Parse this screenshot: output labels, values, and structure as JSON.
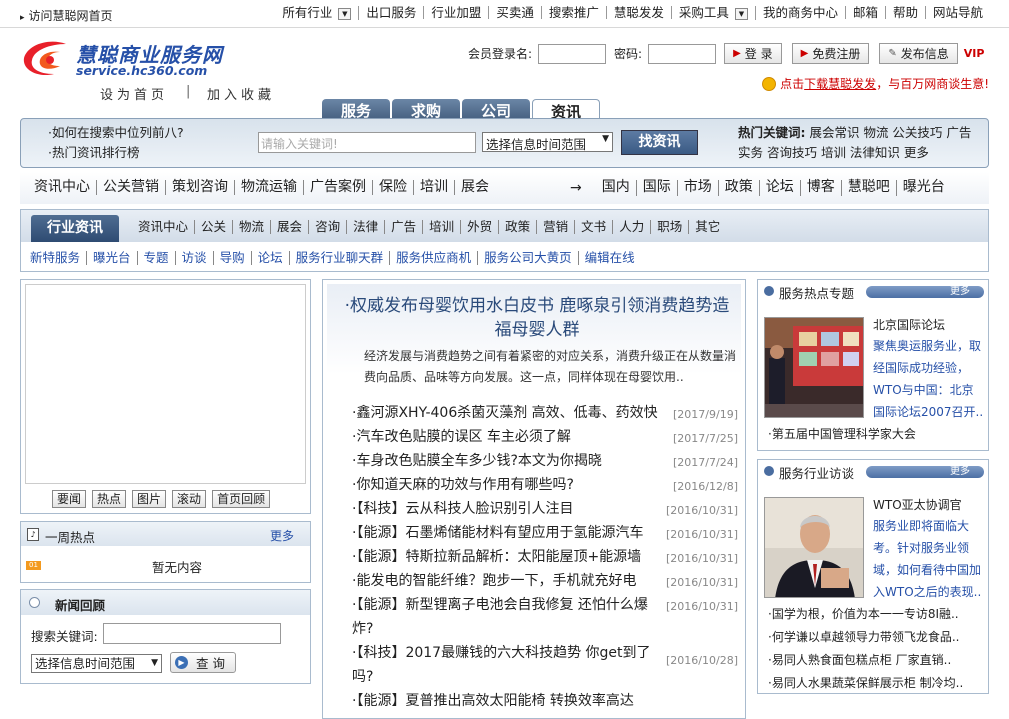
{
  "topbar": {
    "home_link": "访问慧聪网首页",
    "nav": [
      "所有行业",
      "出口服务",
      "行业加盟",
      "买卖通",
      "搜索推广",
      "慧聪发发",
      "采购工具",
      "我的商务中心",
      "邮箱",
      "帮助",
      "网站导航"
    ]
  },
  "logo": {
    "cn": "慧聪商业服务网",
    "en": "service.hc360.com"
  },
  "header_links": {
    "set_home": "设为首页",
    "add_fav": "加入收藏"
  },
  "login": {
    "member_label": "会员登录名:",
    "password_label": "密码:",
    "login_btn": "登 录",
    "register_btn": "免费注册",
    "publish_btn": "发布信息",
    "vip": "VIP"
  },
  "promo": {
    "prefix": "点击",
    "link": "下载慧聪发发",
    "suffix": "，与百万网商谈生意!"
  },
  "tabs": [
    "服务",
    "求购",
    "公司",
    "资讯"
  ],
  "search": {
    "links": [
      "如何在搜索中位列前八?",
      "热门资讯排行榜"
    ],
    "placeholder": "请输入关键词!",
    "select": "选择信息时间范围",
    "button": "找资讯",
    "hot_label": "热门关键词:",
    "hot_words": "展会常识 物流 公关技巧 广告实务 咨询技巧 培训 法律知识 更多"
  },
  "nav1": {
    "left": [
      "资讯中心",
      "公关营销",
      "策划咨询",
      "物流运输",
      "广告案例",
      "保险",
      "培训",
      "展会"
    ],
    "arrow": "→",
    "right": [
      "国内",
      "国际",
      "市场",
      "政策",
      "论坛",
      "博客",
      "慧聪吧",
      "曝光台"
    ]
  },
  "industry": {
    "title": "行业资讯",
    "cats": [
      "资讯中心",
      "公关",
      "物流",
      "展会",
      "咨询",
      "法律",
      "广告",
      "培训",
      "外贸",
      "政策",
      "营销",
      "文书",
      "人力",
      "职场",
      "其它"
    ],
    "links": [
      "新特服务",
      "曝光台",
      "专题",
      "访谈",
      "导购",
      "论坛",
      "服务行业聊天群",
      "服务供应商机",
      "服务公司大黄页",
      "编辑在线"
    ]
  },
  "left": {
    "buttons": [
      "要闻",
      "热点",
      "图片",
      "滚动",
      "首页回顾"
    ],
    "week_title": "一周热点",
    "more": "更多",
    "badge": "01",
    "empty": "暂无内容",
    "news_title": "新闻回顾",
    "kw_label": "搜索关键词:",
    "select": "选择信息时间范围",
    "query_btn": "查 询"
  },
  "headline": {
    "title": "·权威发布母婴饮用水白皮书 鹿啄泉引领消费趋势造福母婴人群",
    "summary": "经济发展与消费趋势之间有着紧密的对应关系，消费升级正在从数量消费向品质、品味等方向发展。这一点，同样体现在母婴饮用.."
  },
  "news_list": [
    {
      "title": "·鑫河源XHY-406杀菌灭藻剂 高效、低毒、药效快",
      "date": "[2017/9/19]"
    },
    {
      "title": "·汽车改色贴膜的误区 车主必须了解",
      "date": "[2017/7/25]"
    },
    {
      "title": "·车身改色贴膜全车多少钱?本文为你揭晓",
      "date": "[2017/7/24]"
    },
    {
      "title": "·你知道天麻的功效与作用有哪些吗?",
      "date": "[2016/12/8]"
    },
    {
      "title": "·【科技】云从科技人脸识别引人注目",
      "date": "[2016/10/31]"
    },
    {
      "title": "·【能源】石墨烯储能材料有望应用于氢能源汽车",
      "date": "[2016/10/31]"
    },
    {
      "title": "·【能源】特斯拉新品解析：太阳能屋顶+能源墙",
      "date": "[2016/10/31]"
    },
    {
      "title": "·能发电的智能纤维？跑步一下，手机就充好电",
      "date": "[2016/10/31]"
    },
    {
      "title": "·【能源】新型锂离子电池会自我修复 还怕什么爆炸?",
      "date": "[2016/10/31]"
    },
    {
      "title": "·【科技】2017最赚钱的六大科技趋势 你get到了吗?",
      "date": "[2016/10/28]"
    },
    {
      "title": "·【能源】夏普推出高效太阳能椅 转换效率高达",
      "date": ""
    }
  ],
  "right": {
    "topic_title": "服务热点专题",
    "more": "更多",
    "topic_label": "北京国际论坛",
    "topic_desc": "聚焦奥运服务业，取经国际成功经验，WTO与中国：北京国际论坛2007召开..",
    "topic_item": "·第五届中国管理科学家大会",
    "interview_title": "服务行业访谈",
    "interview_label": "WTO亚太协调官",
    "interview_desc": "服务业即将面临大考。针对服务业领域，如何看待中国加入WTO之后的表现..",
    "interview_items": [
      "·国学为根，价值为本一一专访8I融..",
      "·何学谦以卓越领导力带领飞龙食品..",
      "·易同人熟食面包糕点柜 厂家直销..",
      "·易同人水果蔬菜保鲜展示柜 制冷均.."
    ]
  }
}
